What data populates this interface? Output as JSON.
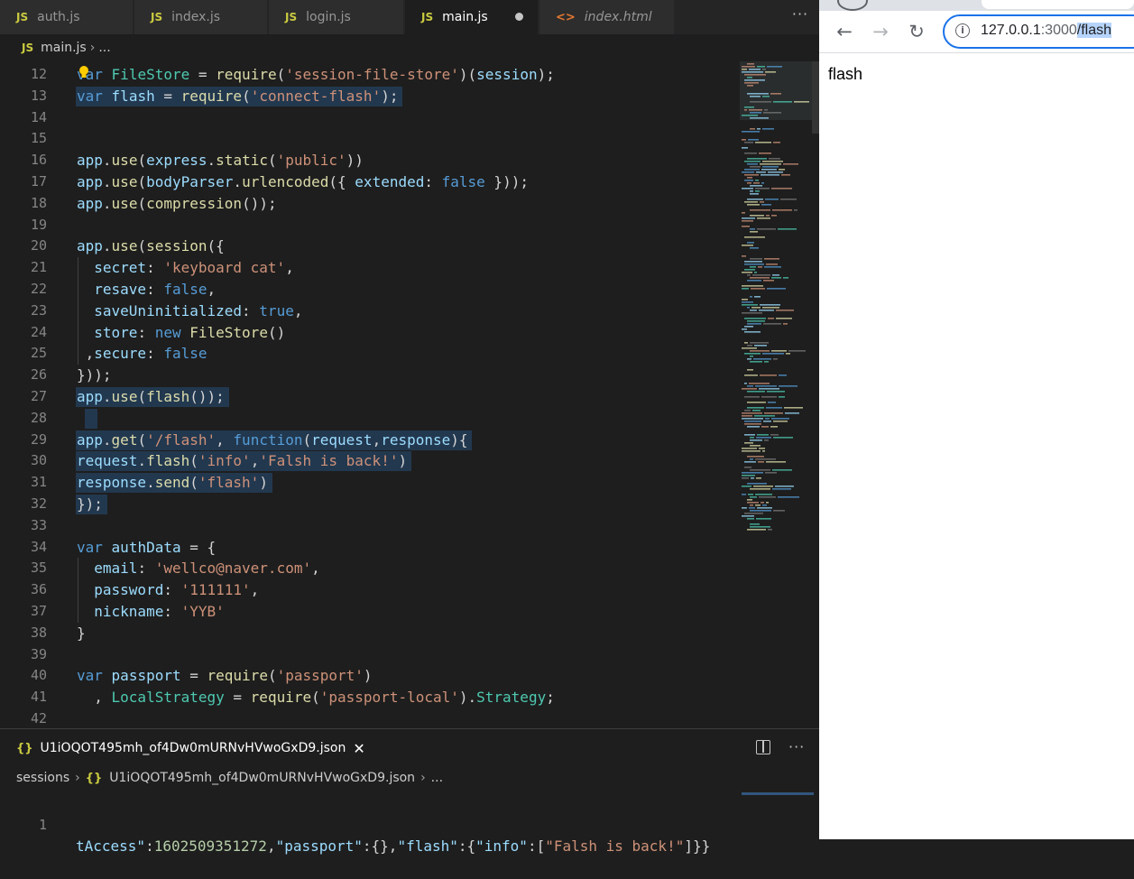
{
  "editor": {
    "tabs": [
      {
        "label": "auth.js",
        "badge": "JS"
      },
      {
        "label": "index.js",
        "badge": "JS"
      },
      {
        "label": "login.js",
        "badge": "JS"
      },
      {
        "label": "main.js",
        "badge": "JS"
      },
      {
        "label": "index.html",
        "badge": "<>"
      }
    ],
    "more_label": "···",
    "breadcrumb": {
      "badge": "JS",
      "file": "main.js",
      "rest": "..."
    },
    "code_lines": [
      {
        "n": "12",
        "tokens": [
          [
            "kw",
            "var"
          ],
          [
            "p",
            " "
          ],
          [
            "cls",
            "FileStore"
          ],
          [
            "p",
            " = "
          ],
          [
            "fn",
            "require"
          ],
          [
            "p",
            "("
          ],
          [
            "str",
            "'session-file-store'"
          ],
          [
            "p",
            ")("
          ],
          [
            "var",
            "session"
          ],
          [
            "p",
            ");"
          ]
        ]
      },
      {
        "n": "13",
        "tokens": [
          [
            "kw",
            "var"
          ],
          [
            "p",
            " "
          ],
          [
            "var",
            "flash"
          ],
          [
            "p",
            " = "
          ],
          [
            "fn",
            "require"
          ],
          [
            "p",
            "("
          ],
          [
            "str",
            "'connect-flash'"
          ],
          [
            "p",
            ");"
          ]
        ]
      },
      {
        "n": "14",
        "tokens": []
      },
      {
        "n": "15",
        "tokens": []
      },
      {
        "n": "16",
        "tokens": [
          [
            "var",
            "app"
          ],
          [
            "p",
            "."
          ],
          [
            "fn",
            "use"
          ],
          [
            "p",
            "("
          ],
          [
            "var",
            "express"
          ],
          [
            "p",
            "."
          ],
          [
            "fn",
            "static"
          ],
          [
            "p",
            "("
          ],
          [
            "str",
            "'public'"
          ],
          [
            "p",
            "))"
          ]
        ]
      },
      {
        "n": "17",
        "tokens": [
          [
            "var",
            "app"
          ],
          [
            "p",
            "."
          ],
          [
            "fn",
            "use"
          ],
          [
            "p",
            "("
          ],
          [
            "var",
            "bodyParser"
          ],
          [
            "p",
            "."
          ],
          [
            "fn",
            "urlencoded"
          ],
          [
            "p",
            "({ "
          ],
          [
            "var",
            "extended"
          ],
          [
            "p",
            ": "
          ],
          [
            "kw",
            "false"
          ],
          [
            "p",
            " }));"
          ]
        ]
      },
      {
        "n": "18",
        "tokens": [
          [
            "var",
            "app"
          ],
          [
            "p",
            "."
          ],
          [
            "fn",
            "use"
          ],
          [
            "p",
            "("
          ],
          [
            "fn",
            "compression"
          ],
          [
            "p",
            "());"
          ]
        ]
      },
      {
        "n": "19",
        "tokens": []
      },
      {
        "n": "20",
        "tokens": [
          [
            "var",
            "app"
          ],
          [
            "p",
            "."
          ],
          [
            "fn",
            "use"
          ],
          [
            "p",
            "("
          ],
          [
            "fn",
            "session"
          ],
          [
            "p",
            "({"
          ]
        ]
      },
      {
        "n": "21",
        "tokens": [
          [
            "p",
            "  "
          ],
          [
            "var",
            "secret"
          ],
          [
            "p",
            ": "
          ],
          [
            "str",
            "'keyboard cat'"
          ],
          [
            "p",
            ","
          ]
        ]
      },
      {
        "n": "22",
        "tokens": [
          [
            "p",
            "  "
          ],
          [
            "var",
            "resave"
          ],
          [
            "p",
            ": "
          ],
          [
            "kw",
            "false"
          ],
          [
            "p",
            ","
          ]
        ]
      },
      {
        "n": "23",
        "tokens": [
          [
            "p",
            "  "
          ],
          [
            "var",
            "saveUninitialized"
          ],
          [
            "p",
            ": "
          ],
          [
            "kw",
            "true"
          ],
          [
            "p",
            ","
          ]
        ]
      },
      {
        "n": "24",
        "tokens": [
          [
            "p",
            "  "
          ],
          [
            "var",
            "store"
          ],
          [
            "p",
            ": "
          ],
          [
            "kw",
            "new"
          ],
          [
            "p",
            " "
          ],
          [
            "fn",
            "FileStore"
          ],
          [
            "p",
            "()"
          ]
        ]
      },
      {
        "n": "25",
        "tokens": [
          [
            "p",
            " ,"
          ],
          [
            "var",
            "secure"
          ],
          [
            "p",
            ": "
          ],
          [
            "kw",
            "false"
          ]
        ]
      },
      {
        "n": "26",
        "tokens": [
          [
            "p",
            "}));"
          ]
        ]
      },
      {
        "n": "27",
        "tokens": [
          [
            "var",
            "app"
          ],
          [
            "p",
            "."
          ],
          [
            "fn",
            "use"
          ],
          [
            "p",
            "("
          ],
          [
            "fn",
            "flash"
          ],
          [
            "p",
            "());"
          ]
        ]
      },
      {
        "n": "28",
        "tokens": []
      },
      {
        "n": "29",
        "tokens": [
          [
            "var",
            "app"
          ],
          [
            "p",
            "."
          ],
          [
            "fn",
            "get"
          ],
          [
            "p",
            "("
          ],
          [
            "str",
            "'/flash'"
          ],
          [
            "p",
            ", "
          ],
          [
            "kw",
            "function"
          ],
          [
            "p",
            "("
          ],
          [
            "var",
            "request"
          ],
          [
            "p",
            ","
          ],
          [
            "var",
            "response"
          ],
          [
            "p",
            "){"
          ]
        ]
      },
      {
        "n": "30",
        "tokens": [
          [
            "var",
            "request"
          ],
          [
            "p",
            "."
          ],
          [
            "fn",
            "flash"
          ],
          [
            "p",
            "("
          ],
          [
            "str",
            "'info'"
          ],
          [
            "p",
            ","
          ],
          [
            "str",
            "'Falsh is back!'"
          ],
          [
            "p",
            ")"
          ]
        ]
      },
      {
        "n": "31",
        "tokens": [
          [
            "var",
            "response"
          ],
          [
            "p",
            "."
          ],
          [
            "fn",
            "send"
          ],
          [
            "p",
            "("
          ],
          [
            "str",
            "'flash'"
          ],
          [
            "p",
            ")"
          ]
        ]
      },
      {
        "n": "32",
        "tokens": [
          [
            "p",
            "});"
          ]
        ]
      },
      {
        "n": "33",
        "tokens": []
      },
      {
        "n": "34",
        "tokens": [
          [
            "kw",
            "var"
          ],
          [
            "p",
            " "
          ],
          [
            "var",
            "authData"
          ],
          [
            "p",
            " = {"
          ]
        ]
      },
      {
        "n": "35",
        "tokens": [
          [
            "p",
            "  "
          ],
          [
            "var",
            "email"
          ],
          [
            "p",
            ": "
          ],
          [
            "str",
            "'wellco@naver.com'"
          ],
          [
            "p",
            ","
          ]
        ]
      },
      {
        "n": "36",
        "tokens": [
          [
            "p",
            "  "
          ],
          [
            "var",
            "password"
          ],
          [
            "p",
            ": "
          ],
          [
            "str",
            "'111111'"
          ],
          [
            "p",
            ","
          ]
        ]
      },
      {
        "n": "37",
        "tokens": [
          [
            "p",
            "  "
          ],
          [
            "var",
            "nickname"
          ],
          [
            "p",
            ": "
          ],
          [
            "str",
            "'YYB'"
          ]
        ]
      },
      {
        "n": "38",
        "tokens": [
          [
            "p",
            "}"
          ]
        ]
      },
      {
        "n": "39",
        "tokens": []
      },
      {
        "n": "40",
        "tokens": [
          [
            "kw",
            "var"
          ],
          [
            "p",
            " "
          ],
          [
            "var",
            "passport"
          ],
          [
            "p",
            " = "
          ],
          [
            "fn",
            "require"
          ],
          [
            "p",
            "("
          ],
          [
            "str",
            "'passport'"
          ],
          [
            "p",
            ")"
          ]
        ]
      },
      {
        "n": "41",
        "tokens": [
          [
            "p",
            "  , "
          ],
          [
            "cls",
            "LocalStrategy"
          ],
          [
            "p",
            " = "
          ],
          [
            "fn",
            "require"
          ],
          [
            "p",
            "("
          ],
          [
            "str",
            "'passport-local'"
          ],
          [
            "p",
            ")."
          ],
          [
            "cls",
            "Strategy"
          ],
          [
            "p",
            ";"
          ]
        ]
      },
      {
        "n": "42",
        "tokens": []
      }
    ],
    "highlighted_lines": [
      "13",
      "27",
      "28",
      "29",
      "30",
      "31",
      "32"
    ]
  },
  "panel": {
    "tab_label": "U1iOQOT495mh_of4Dw0mURNvHVwoGxD9.json",
    "badge": "{}",
    "close_label": "✕",
    "more_label": "···",
    "breadcrumb": {
      "root": "sessions",
      "badge": "{}",
      "file": "U1iOQOT495mh_of4Dw0mURNvHVwoGxD9.json",
      "rest": "..."
    },
    "line": {
      "n": "1",
      "tokens": [
        [
          "var",
          "tAccess\""
        ],
        [
          "p",
          ":"
        ],
        [
          "num",
          "1602509351272"
        ],
        [
          "p",
          ","
        ],
        [
          "var",
          "\"passport\""
        ],
        [
          "p",
          ":{},"
        ],
        [
          "var",
          "\"flash\""
        ],
        [
          "p",
          ":{"
        ],
        [
          "var",
          "\"info\""
        ],
        [
          "p",
          ":["
        ],
        [
          "str",
          "\"Falsh is back!\""
        ],
        [
          "p",
          "]}}"
        ]
      ]
    }
  },
  "browser": {
    "url": {
      "host": "127.0.0.1",
      "port": ":3000",
      "path": "/flash"
    },
    "back_icon": "←",
    "forward_icon": "→",
    "reload_icon": "↻",
    "page_text": "flash"
  },
  "colors": {
    "editor_bg": "#1e1e1e",
    "tab_bg": "#2d2d2d",
    "selection": "#264f78",
    "keyword": "#569cd6",
    "variable": "#9cdcfe",
    "function": "#dcdcaa",
    "string": "#ce9178",
    "class": "#4ec9b0",
    "number": "#b5cea8",
    "omnibox_border": "#1a73e8"
  }
}
